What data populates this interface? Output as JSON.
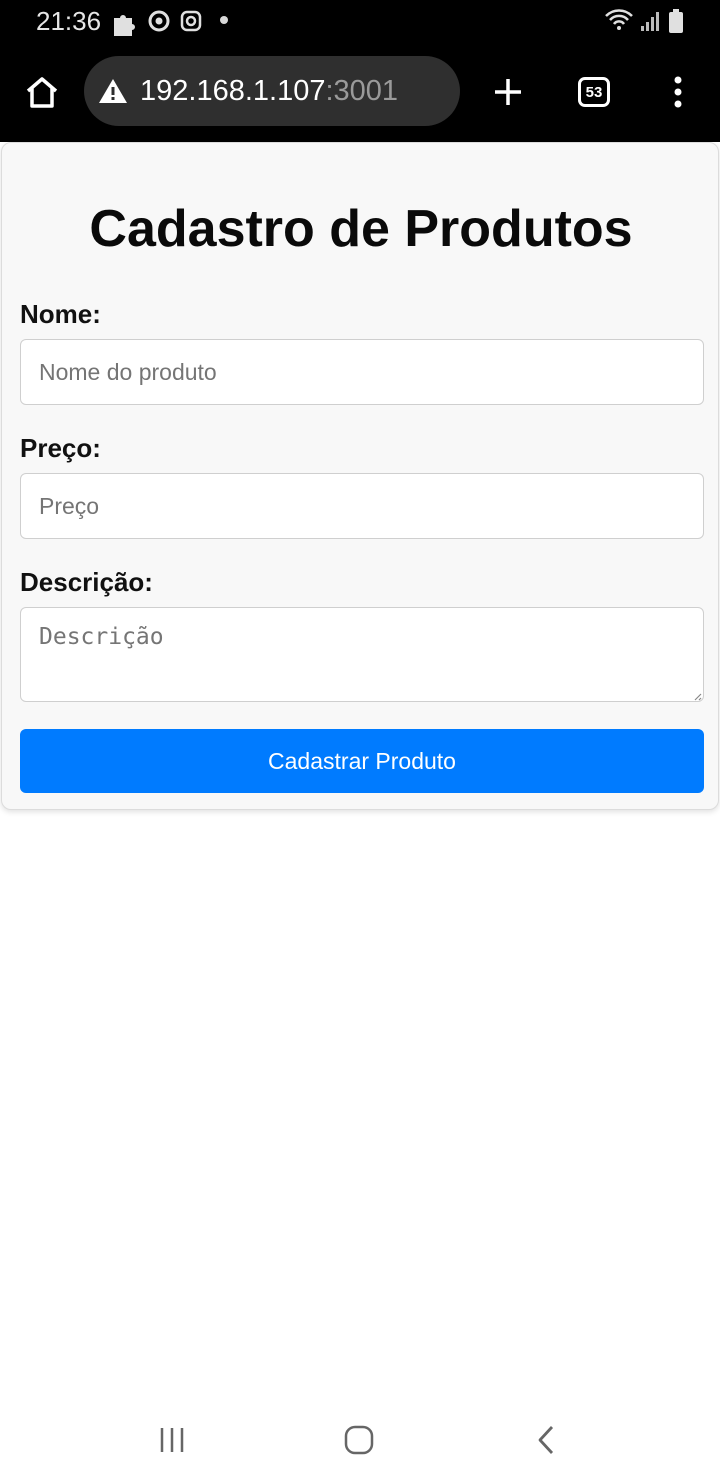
{
  "status_bar": {
    "time": "21:36",
    "icons": [
      "puzzle-icon",
      "chrome-icon",
      "instagram-icon",
      "notification-dot",
      "wifi-icon",
      "signal-icon",
      "battery-icon"
    ]
  },
  "browser": {
    "url_host": "192.168.1.107",
    "url_port": ":3001",
    "tab_count": "53",
    "icons": [
      "home-icon",
      "warning-icon",
      "plus-icon",
      "tabs-icon",
      "more-vert-icon"
    ]
  },
  "form": {
    "title": "Cadastro de Produtos",
    "name_label": "Nome:",
    "name_placeholder": "Nome do produto",
    "price_label": "Preço:",
    "price_placeholder": "Preço",
    "description_label": "Descrição:",
    "description_placeholder": "Descrição",
    "submit_label": "Cadastrar Produto"
  },
  "nav_bar": {
    "icons": [
      "recent-apps-icon",
      "home-nav-icon",
      "back-icon"
    ]
  },
  "colors": {
    "accent": "#007bff",
    "card_background": "#f8f8f8",
    "toolbar_background": "#000000"
  }
}
